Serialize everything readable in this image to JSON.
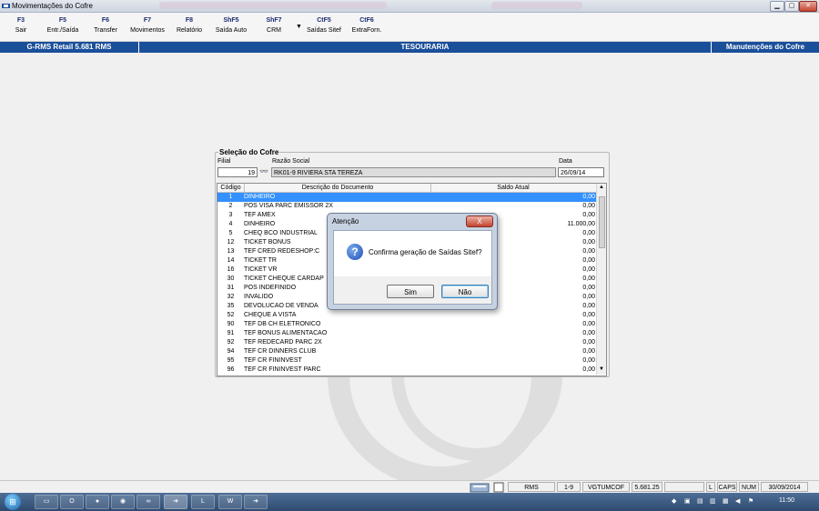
{
  "window": {
    "title": "Movimentações do Cofre"
  },
  "toolbar": {
    "items": [
      {
        "key": "F3",
        "label": "Sair"
      },
      {
        "key": "F5",
        "label": "Entr./Saída"
      },
      {
        "key": "F6",
        "label": "Transfer"
      },
      {
        "key": "F7",
        "label": "Movimentos"
      },
      {
        "key": "F8",
        "label": "Relatório"
      },
      {
        "key": "ShF5",
        "label": "Saída Auto"
      },
      {
        "key": "ShF7",
        "label": "CRM"
      },
      {
        "key": "CtF5",
        "label": "Saídas Sitef"
      },
      {
        "key": "CtF6",
        "label": "ExtraForn."
      }
    ]
  },
  "header": {
    "app": "G-RMS Retail 5.681 RMS",
    "module": "TESOURARIA",
    "section": "Manutenções do Cofre"
  },
  "cofre": {
    "group_title": "Seleção do Cofre",
    "filial_label": "Filial",
    "filial_value": "19",
    "razao_label": "Razão Social",
    "razao_value": "RK01-9 RIVIERA STA TEREZA",
    "data_label": "Data",
    "data_value": "26/09/14"
  },
  "table": {
    "headers": [
      "Código",
      "Descrição do Documento",
      "Saldo Atual"
    ],
    "rows": [
      [
        "1",
        "DINHEIRO",
        "0,00"
      ],
      [
        "2",
        "POS VISA PARC EMISSOR 2X",
        "0,00"
      ],
      [
        "3",
        "TEF AMEX",
        "0,00"
      ],
      [
        "4",
        "DINHEIRO",
        "11.000,00"
      ],
      [
        "5",
        "CHEQ BCO INDUSTRIAL",
        "0,00"
      ],
      [
        "12",
        "TICKET BONUS",
        "0,00"
      ],
      [
        "13",
        "TEF CRED REDESHOP:C",
        "0,00"
      ],
      [
        "14",
        "TICKET TR",
        "0,00"
      ],
      [
        "16",
        "TICKET VR",
        "0,00"
      ],
      [
        "30",
        "TICKET CHEQUE CARDAP",
        "0,00"
      ],
      [
        "31",
        "POS INDEFINIDO",
        "0,00"
      ],
      [
        "32",
        "INVALIDO",
        "0,00"
      ],
      [
        "35",
        "DEVOLUCAO DE VENDA",
        "0,00"
      ],
      [
        "52",
        "CHEQUE A VISTA",
        "0,00"
      ],
      [
        "90",
        "TEF DB CH ELETRONICO",
        "0,00"
      ],
      [
        "91",
        "TEF BONUS ALIMENTACAO",
        "0,00"
      ],
      [
        "92",
        "TEF REDECARD PARC 2X",
        "0,00"
      ],
      [
        "94",
        "TEF CR DINNERS CLUB",
        "0,00"
      ],
      [
        "95",
        "TEF CR FININVEST",
        "0,00"
      ],
      [
        "96",
        "TEF CR FININVEST PARC",
        "0,00"
      ]
    ]
  },
  "dialog": {
    "title": "Atenção",
    "message": "Confirma geração de Saídas Sitef?",
    "yes": "Sim",
    "no": "Não",
    "close": "X"
  },
  "status": {
    "items": [
      "RMS",
      "1-9",
      "VGTUMCOF",
      "5.681.25",
      "",
      "L",
      "CAPS",
      "NUM",
      "30/09/2014"
    ]
  },
  "taskbar": {
    "clock": "11:50"
  },
  "colors": {
    "header_blue": "#1a4f9a",
    "selection": "#3390ff"
  }
}
